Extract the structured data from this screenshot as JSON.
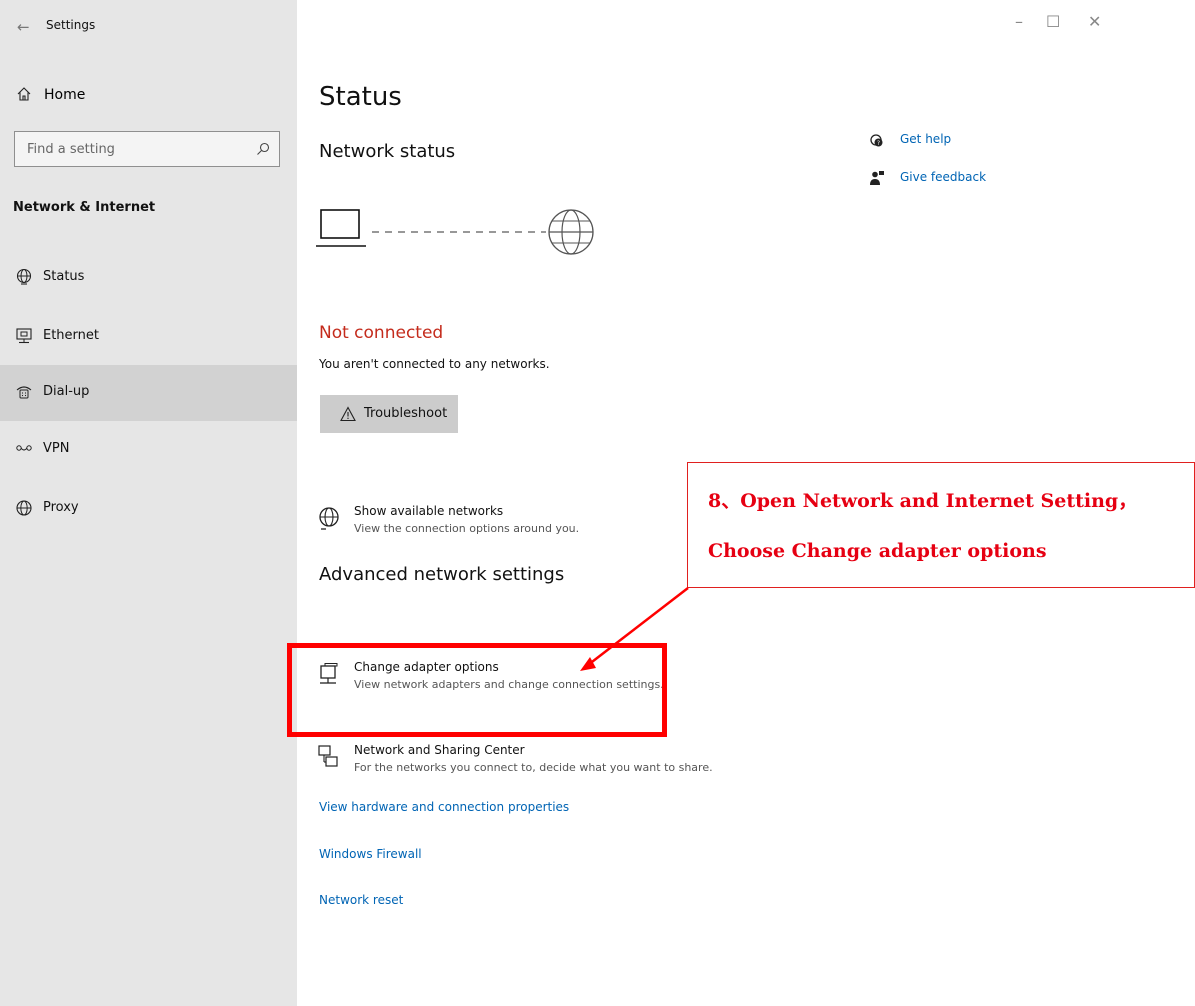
{
  "window": {
    "title": "Settings",
    "back_icon": "back-arrow-icon",
    "controls": {
      "minimize": "–",
      "maximize": "☐",
      "close": "✕"
    }
  },
  "sidebar": {
    "home_label": "Home",
    "search_placeholder": "Find a setting",
    "section_title": "Network & Internet",
    "items": [
      {
        "label": "Status",
        "icon": "status-globe-icon"
      },
      {
        "label": "Ethernet",
        "icon": "ethernet-icon"
      },
      {
        "label": "Dial-up",
        "icon": "dial-up-icon",
        "selected": true
      },
      {
        "label": "VPN",
        "icon": "vpn-icon"
      },
      {
        "label": "Proxy",
        "icon": "proxy-globe-icon"
      }
    ]
  },
  "main": {
    "page_title": "Status",
    "network_status_heading": "Network status",
    "connection": {
      "state": "Not connected",
      "detail": "You aren't connected to any networks.",
      "state_color": "#c42b1c"
    },
    "troubleshoot_label": "Troubleshoot",
    "show_networks": {
      "title": "Show available networks",
      "desc": "View the connection options around you."
    },
    "advanced_heading": "Advanced network settings",
    "change_adapter": {
      "title": "Change adapter options",
      "desc": "View network adapters and change connection settings."
    },
    "sharing_center": {
      "title": "Network and Sharing Center",
      "desc": "For the networks you connect to, decide what you want to share."
    },
    "links": [
      "View hardware and connection properties",
      "Windows Firewall",
      "Network reset"
    ],
    "link_color": "#0064b4"
  },
  "right_links": {
    "get_help": "Get help",
    "give_feedback": "Give feedback"
  },
  "annotation": {
    "line1": "8、Open Network and Internet Setting，",
    "line2": "Choose Change adapter options",
    "color": "#e60012"
  }
}
